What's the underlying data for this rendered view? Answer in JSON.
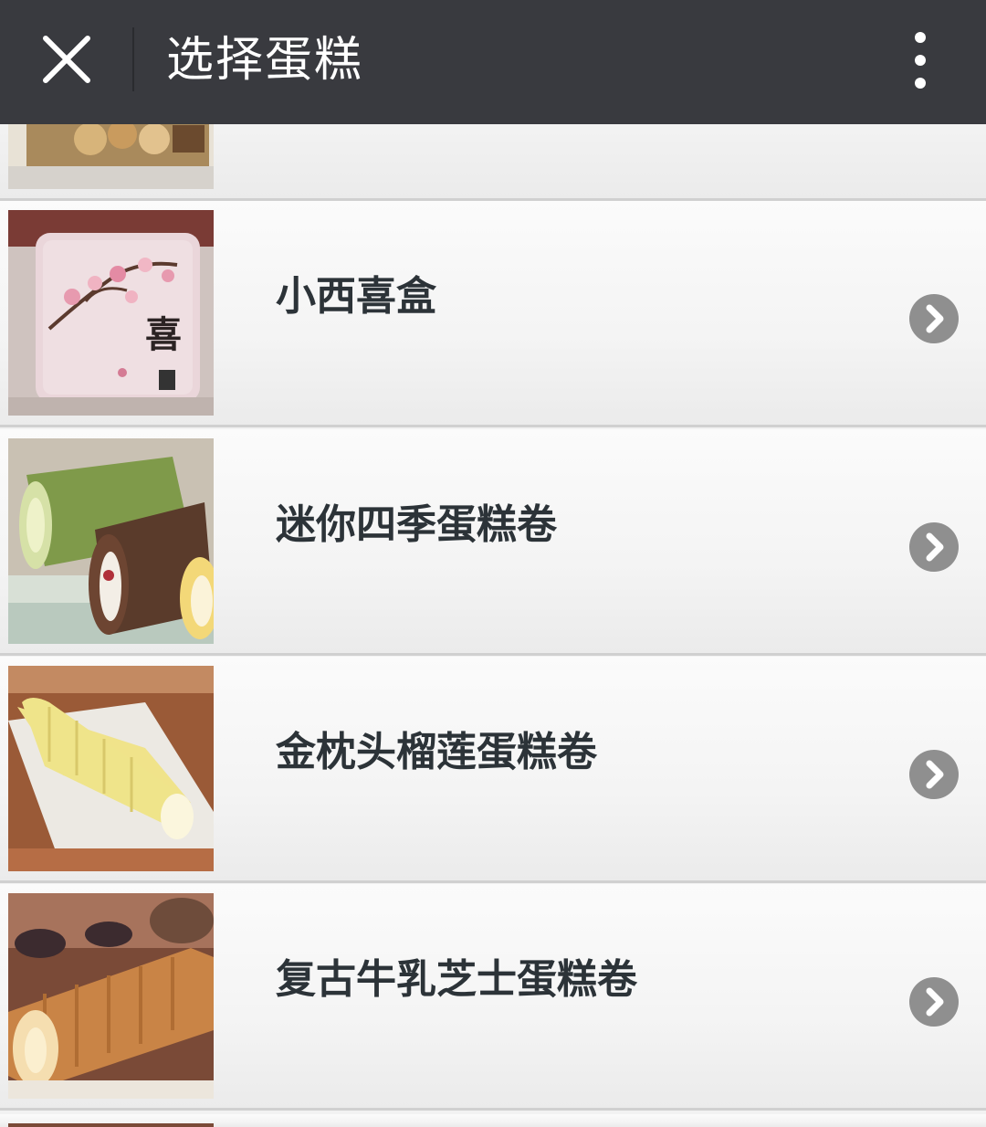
{
  "header": {
    "title": "选择蛋糕",
    "close_icon": "close-icon",
    "more_icon": "more-vertical-icon",
    "background": "#393a3f"
  },
  "list": {
    "items": [
      {
        "label": "",
        "thumb": "cookie-box-thumbnail",
        "chevron_icon": "chevron-right-circle-icon"
      },
      {
        "label": "小西喜盒",
        "thumb": "gift-tin-thumbnail",
        "chevron_icon": "chevron-right-circle-icon"
      },
      {
        "label": "迷你四季蛋糕卷",
        "thumb": "cake-rolls-thumbnail",
        "chevron_icon": "chevron-right-circle-icon"
      },
      {
        "label": "金枕头榴莲蛋糕卷",
        "thumb": "durian-roll-thumbnail",
        "chevron_icon": "chevron-right-circle-icon"
      },
      {
        "label": "复古牛乳芝士蛋糕卷",
        "thumb": "cheese-roll-thumbnail",
        "chevron_icon": "chevron-right-circle-icon"
      }
    ]
  },
  "colors": {
    "label_text": "#2c3338",
    "chevron": "#8f8f8f",
    "row_divider": "#d0d0d0"
  }
}
